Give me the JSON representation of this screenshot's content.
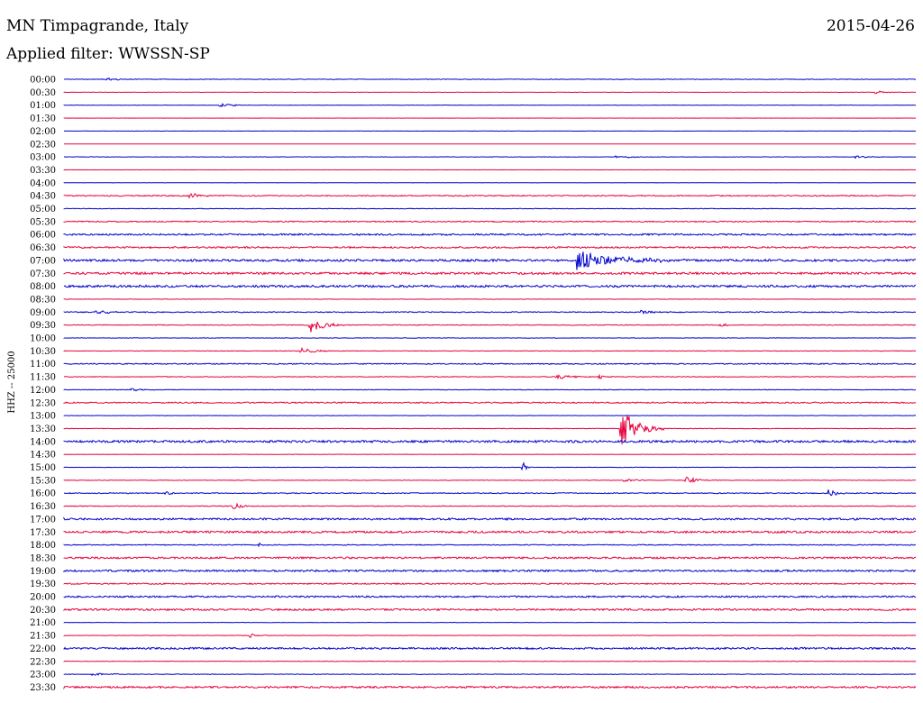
{
  "header": {
    "station": "MN Timpagrande, Italy",
    "date": "2015-04-26",
    "filter": "Applied filter: WWSSN-SP"
  },
  "colors": {
    "even_line": "#0000cc",
    "odd_line": "#e8003c"
  },
  "chart_data": {
    "type": "line",
    "title": "MN Timpagrande, Italy",
    "subtitle": "Applied filter: WWSSN-SP",
    "ylabel": "HHZ -- 25000",
    "row_labels": [
      "00:00",
      "00:30",
      "01:00",
      "01:30",
      "02:00",
      "02:30",
      "03:00",
      "03:30",
      "04:00",
      "04:30",
      "05:00",
      "05:30",
      "06:00",
      "06:30",
      "07:00",
      "07:30",
      "08:00",
      "08:30",
      "09:00",
      "09:30",
      "10:00",
      "10:30",
      "11:00",
      "11:30",
      "12:00",
      "12:30",
      "13:00",
      "13:30",
      "14:00",
      "14:30",
      "15:00",
      "15:30",
      "16:00",
      "16:30",
      "17:00",
      "17:30",
      "18:00",
      "18:30",
      "19:00",
      "19:30",
      "20:00",
      "20:30",
      "21:00",
      "21:30",
      "22:00",
      "22:30",
      "23:00",
      "23:30"
    ],
    "row_noise": [
      0.3,
      0.2,
      0.2,
      0.1,
      0.1,
      0.1,
      0.2,
      0.1,
      0.1,
      0.6,
      0.3,
      0.6,
      0.9,
      0.9,
      1.2,
      1.2,
      1.2,
      0.2,
      0.5,
      0.4,
      0.2,
      0.3,
      0.6,
      0.4,
      0.3,
      0.7,
      0.2,
      0.3,
      1.2,
      0.2,
      0.2,
      0.3,
      0.5,
      0.4,
      1.0,
      1.1,
      0.5,
      1.0,
      1.0,
      0.7,
      0.9,
      1.0,
      0.2,
      0.2,
      1.0,
      0.3,
      0.3,
      1.0
    ],
    "events": [
      {
        "row": 0,
        "t": 0.05,
        "amp": 1.5,
        "dur": 0.04
      },
      {
        "row": 1,
        "t": 0.955,
        "amp": 2,
        "dur": 0.02
      },
      {
        "row": 2,
        "t": 0.185,
        "amp": 2,
        "dur": 0.04
      },
      {
        "row": 6,
        "t": 0.65,
        "amp": 1.5,
        "dur": 0.06
      },
      {
        "row": 6,
        "t": 0.93,
        "amp": 1.5,
        "dur": 0.04
      },
      {
        "row": 9,
        "t": 0.15,
        "amp": 3,
        "dur": 0.03
      },
      {
        "row": 14,
        "t": 0.605,
        "amp": 10,
        "dur": 0.13
      },
      {
        "row": 18,
        "t": 0.04,
        "amp": 2,
        "dur": 0.05
      },
      {
        "row": 18,
        "t": 0.68,
        "amp": 2,
        "dur": 0.03
      },
      {
        "row": 19,
        "t": 0.29,
        "amp": 9,
        "dur": 0.04
      },
      {
        "row": 19,
        "t": 0.77,
        "amp": 3,
        "dur": 0.02
      },
      {
        "row": 21,
        "t": 0.28,
        "amp": 3,
        "dur": 0.04
      },
      {
        "row": 23,
        "t": 0.58,
        "amp": 3,
        "dur": 0.04
      },
      {
        "row": 23,
        "t": 0.63,
        "amp": 2,
        "dur": 0.02
      },
      {
        "row": 24,
        "t": 0.08,
        "amp": 1.5,
        "dur": 0.04
      },
      {
        "row": 27,
        "t": 0.655,
        "amp": 22,
        "dur": 0.05
      },
      {
        "row": 30,
        "t": 0.54,
        "amp": 5,
        "dur": 0.01
      },
      {
        "row": 31,
        "t": 0.73,
        "amp": 4,
        "dur": 0.04
      },
      {
        "row": 31,
        "t": 0.66,
        "amp": 2,
        "dur": 0.03
      },
      {
        "row": 32,
        "t": 0.12,
        "amp": 2,
        "dur": 0.03
      },
      {
        "row": 32,
        "t": 0.9,
        "amp": 4,
        "dur": 0.02
      },
      {
        "row": 33,
        "t": 0.2,
        "amp": 3,
        "dur": 0.03
      },
      {
        "row": 36,
        "t": 0.23,
        "amp": 2,
        "dur": 0.01
      },
      {
        "row": 43,
        "t": 0.22,
        "amp": 2,
        "dur": 0.02
      },
      {
        "row": 46,
        "t": 0.035,
        "amp": 2,
        "dur": 0.02
      },
      {
        "row": 46,
        "t": 0.06,
        "amp": 2,
        "dur": 0.01
      }
    ]
  }
}
